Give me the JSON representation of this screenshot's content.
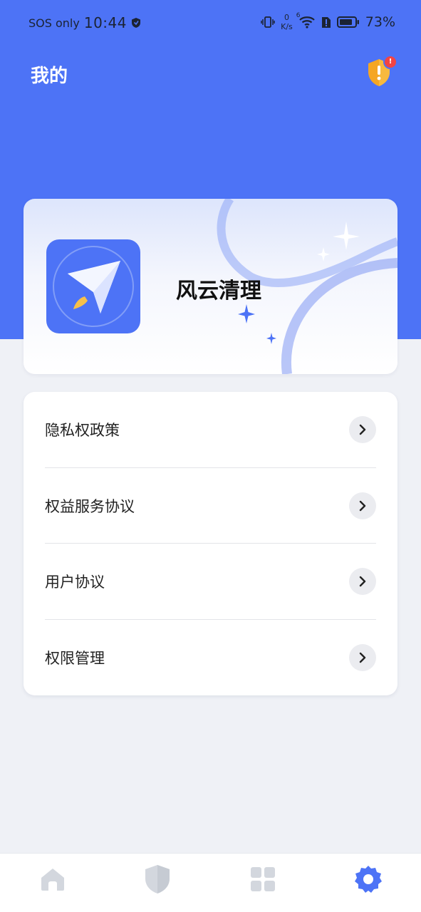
{
  "status_bar": {
    "network": "SOS only",
    "time": "10:44",
    "speed_value": "0",
    "speed_unit": "K/s",
    "wifi_badge": "6",
    "battery": "73%"
  },
  "header": {
    "title": "我的",
    "alert_badge": "!",
    "alert_count": "1"
  },
  "app_card": {
    "name": "风云清理"
  },
  "menu": {
    "items": [
      {
        "label": "隐私权政策"
      },
      {
        "label": "权益服务协议"
      },
      {
        "label": "用户协议"
      },
      {
        "label": "权限管理"
      }
    ]
  },
  "bottom_nav": {
    "items": [
      {
        "icon": "home-icon",
        "active": false
      },
      {
        "icon": "shield-icon",
        "active": false
      },
      {
        "icon": "apps-grid-icon",
        "active": false
      },
      {
        "icon": "settings-gear-icon",
        "active": true
      }
    ],
    "active_color": "#4d73f6",
    "inactive_color": "#d3d7de"
  },
  "colors": {
    "brand_blue": "#4d73f6",
    "background": "#eff1f6",
    "alert_orange": "#f5a623",
    "alert_red": "#f24444"
  }
}
